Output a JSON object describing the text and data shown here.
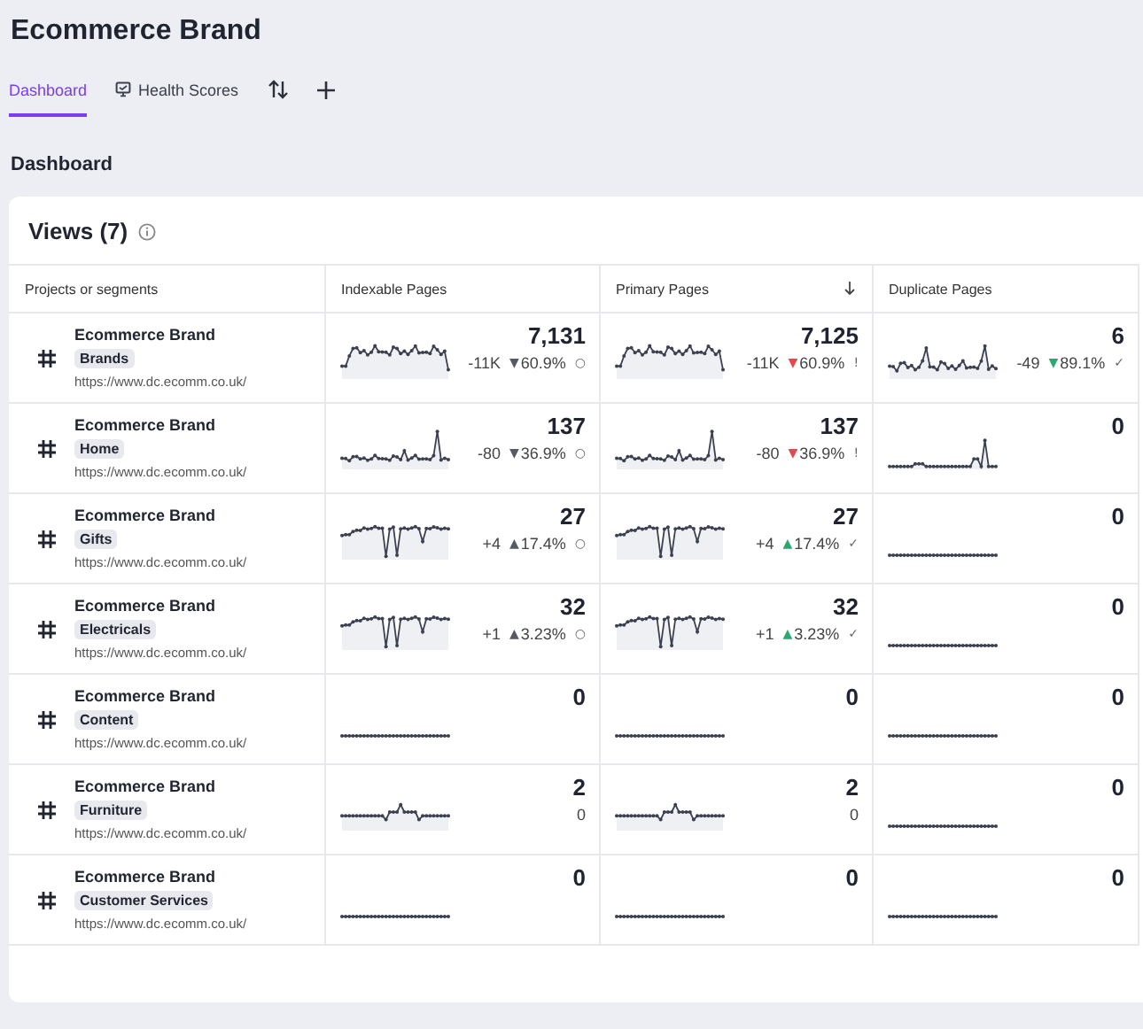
{
  "header": {
    "title": "Ecommerce Brand"
  },
  "tabs": [
    {
      "label": "Dashboard",
      "kind": "text",
      "selected": true
    },
    {
      "label": "Health Scores",
      "kind": "icon-text",
      "selected": false
    },
    {
      "kind": "sort",
      "selected": false
    },
    {
      "kind": "add",
      "selected": false
    }
  ],
  "section_title": "Dashboard",
  "views": {
    "title": "Views (7)",
    "columns": [
      {
        "label": "Projects or segments",
        "sorted": false
      },
      {
        "label": "Indexable Pages",
        "sorted": false
      },
      {
        "label": "Primary Pages",
        "sorted": true
      },
      {
        "label": "Duplicate Pages",
        "sorted": false
      }
    ],
    "rows": [
      {
        "project": "Ecommerce Brand",
        "segment": "Brands",
        "url": "https://www.dc.ecomm.co.uk/",
        "metrics": [
          {
            "kind": "volatile",
            "value": "7,131",
            "delta": "-11K",
            "arrow": "▼",
            "color": "#555a66",
            "pct": "60.9%",
            "status": "○"
          },
          {
            "kind": "volatile",
            "value": "7,125",
            "delta": "-11K",
            "arrow": "▼",
            "color": "#e5484d",
            "pct": "60.9%",
            "status": "!"
          },
          {
            "kind": "noisy",
            "value": "6",
            "delta": "-49",
            "arrow": "▼",
            "color": "#2aa870",
            "pct": "89.1%",
            "status": "✓"
          }
        ]
      },
      {
        "project": "Ecommerce Brand",
        "segment": "Home",
        "url": "https://www.dc.ecomm.co.uk/",
        "metrics": [
          {
            "kind": "spike",
            "value": "137",
            "delta": "-80",
            "arrow": "▼",
            "color": "#555a66",
            "pct": "36.9%",
            "status": "○"
          },
          {
            "kind": "spike",
            "value": "137",
            "delta": "-80",
            "arrow": "▼",
            "color": "#e5484d",
            "pct": "36.9%",
            "status": "!"
          },
          {
            "kind": "lowspike",
            "value": "0"
          }
        ]
      },
      {
        "project": "Ecommerce Brand",
        "segment": "Gifts",
        "url": "https://www.dc.ecomm.co.uk/",
        "metrics": [
          {
            "kind": "dips",
            "value": "27",
            "delta": "+4",
            "arrow": "▲",
            "color": "#555a66",
            "pct": "17.4%",
            "status": "○"
          },
          {
            "kind": "dips",
            "value": "27",
            "delta": "+4",
            "arrow": "▲",
            "color": "#2aa870",
            "pct": "17.4%",
            "status": "✓"
          },
          {
            "kind": "flat",
            "value": "0"
          }
        ]
      },
      {
        "project": "Ecommerce Brand",
        "segment": "Electricals",
        "url": "https://www.dc.ecomm.co.uk/",
        "metrics": [
          {
            "kind": "dips",
            "value": "32",
            "delta": "+1",
            "arrow": "▲",
            "color": "#555a66",
            "pct": "3.23%",
            "status": "○"
          },
          {
            "kind": "dips",
            "value": "32",
            "delta": "+1",
            "arrow": "▲",
            "color": "#2aa870",
            "pct": "3.23%",
            "status": "✓"
          },
          {
            "kind": "flat",
            "value": "0"
          }
        ]
      },
      {
        "project": "Ecommerce Brand",
        "segment": "Content",
        "url": "https://www.dc.ecomm.co.uk/",
        "metrics": [
          {
            "kind": "flat",
            "value": "0"
          },
          {
            "kind": "flat",
            "value": "0"
          },
          {
            "kind": "flat",
            "value": "0"
          }
        ]
      },
      {
        "project": "Ecommerce Brand",
        "segment": "Furniture",
        "url": "https://www.dc.ecomm.co.uk/",
        "metrics": [
          {
            "kind": "bump",
            "value": "2",
            "delta": "0"
          },
          {
            "kind": "bump",
            "value": "2",
            "delta": "0"
          },
          {
            "kind": "flat",
            "value": "0"
          }
        ]
      },
      {
        "project": "Ecommerce Brand",
        "segment": "Customer Services",
        "url": "https://www.dc.ecomm.co.uk/",
        "metrics": [
          {
            "kind": "flat",
            "value": "0"
          },
          {
            "kind": "flat",
            "value": "0"
          },
          {
            "kind": "flat",
            "value": "0"
          }
        ]
      }
    ]
  }
}
